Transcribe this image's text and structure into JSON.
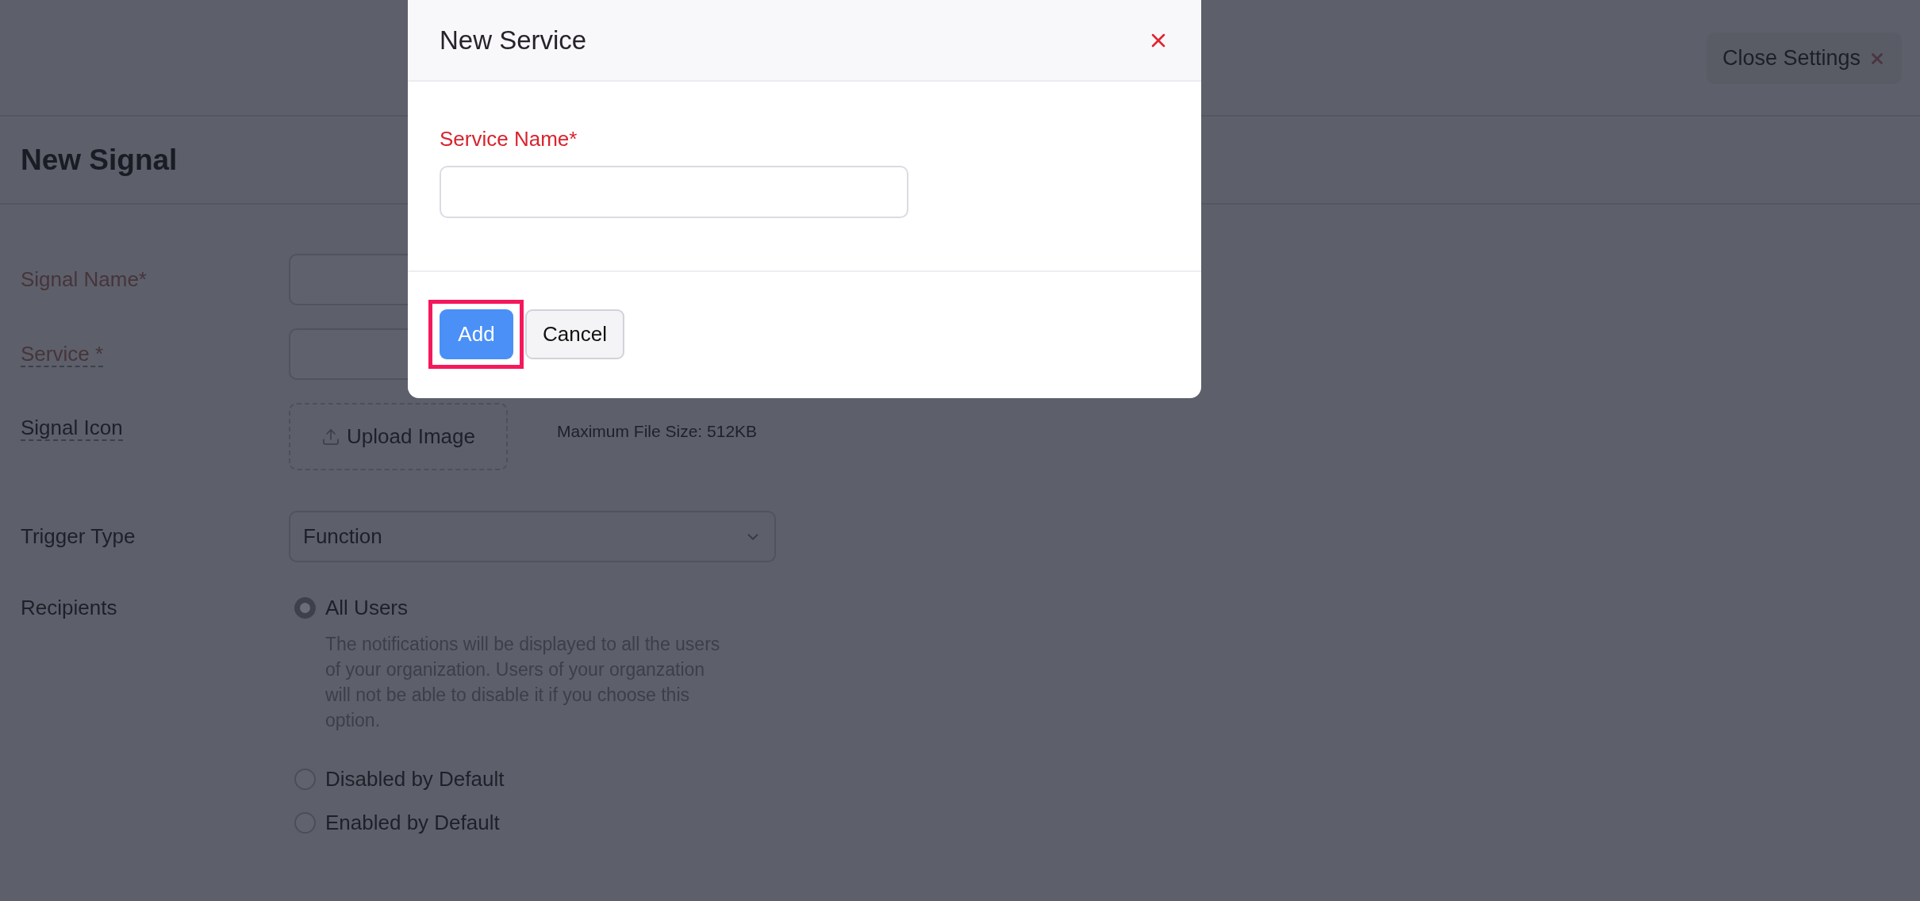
{
  "header": {
    "close_button": {
      "label": "Close Settings"
    }
  },
  "page_title": "New Signal",
  "form": {
    "fields": [
      {
        "kind": "text",
        "label": "Signal Name*",
        "required": true,
        "has_tooltip": false
      },
      {
        "kind": "text",
        "label": "Service *",
        "required": true,
        "has_tooltip": true
      },
      {
        "kind": "upload",
        "label": "Signal Icon",
        "required": false,
        "has_tooltip": true,
        "button": "Upload Image",
        "note": "Maximum File Size: 512KB"
      },
      {
        "kind": "select",
        "label": "Trigger Type",
        "required": false,
        "has_tooltip": false,
        "value": "Function"
      },
      {
        "kind": "radio",
        "label": "Recipients",
        "required": false,
        "has_tooltip": false,
        "options": [
          {
            "label": "All Users",
            "selected": true,
            "description": "The notifications will be displayed to all the users of your organization. Users of your organzation will not be able to disable it if you choose this option."
          },
          {
            "label": "Disabled by Default",
            "selected": false
          },
          {
            "label": "Enabled by Default",
            "selected": false
          }
        ]
      }
    ]
  },
  "dialog": {
    "title": "New Service",
    "fields": [
      {
        "label": "Service Name*",
        "required": true
      }
    ],
    "buttons": [
      {
        "label": "Add",
        "kind": "primary",
        "highlighted": true
      },
      {
        "label": "Cancel",
        "kind": "secondary",
        "highlighted": false
      }
    ]
  }
}
